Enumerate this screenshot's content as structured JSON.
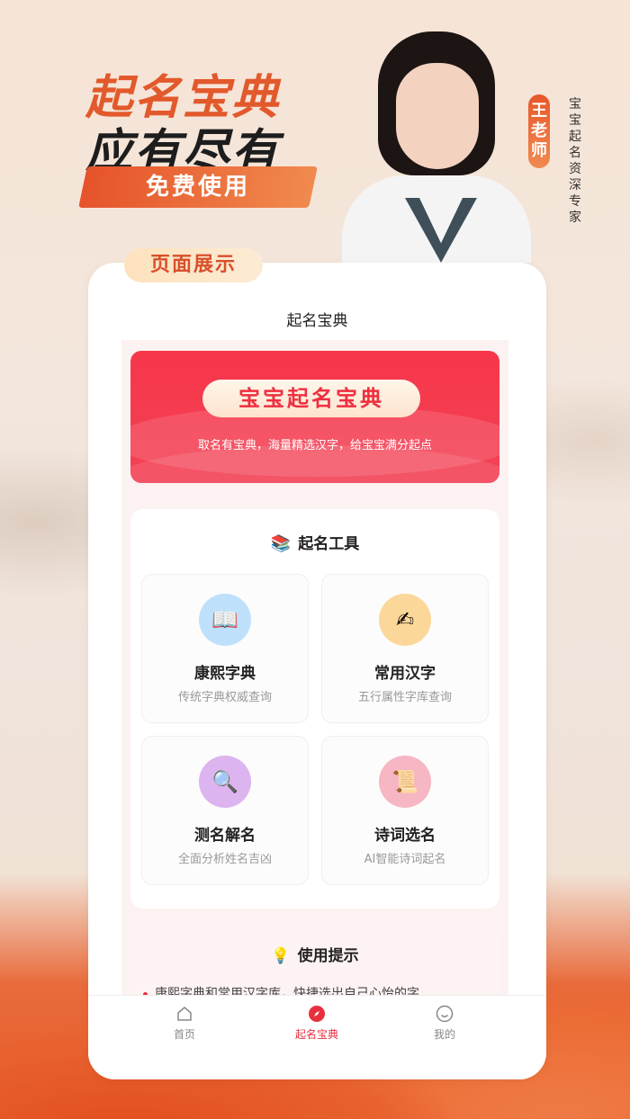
{
  "hero": {
    "line1": "起名宝典",
    "line2": "应有尽有",
    "free": "免费使用"
  },
  "teacher": {
    "name": "王老师",
    "title": "宝宝起名资深专家"
  },
  "page_tag": "页面展示",
  "app": {
    "nav_title": "起名宝典",
    "banner": {
      "pill": "宝宝起名宝典",
      "subtitle": "取名有宝典，海量精选汉字，给宝宝满分起点"
    },
    "tools": {
      "title": "起名工具",
      "icon": "books-icon",
      "items": [
        {
          "name": "康熙字典",
          "desc": "传统字典权威查询",
          "icon": "book-icon",
          "color": "#bfe0fb"
        },
        {
          "name": "常用汉字",
          "desc": "五行属性字库查询",
          "icon": "writing-icon",
          "color": "#fcd79a"
        },
        {
          "name": "测名解名",
          "desc": "全面分析姓名吉凶",
          "icon": "magnifier-icon",
          "color": "#dcb4ef"
        },
        {
          "name": "诗词选名",
          "desc": "AI智能诗词起名",
          "icon": "scroll-icon",
          "color": "#f7b6c3"
        }
      ]
    },
    "tips": {
      "title": "使用提示",
      "icon": "lightbulb-icon",
      "line": "康熙字典和常用汉字库，快捷选出自己心怡的字"
    },
    "tabbar": [
      {
        "label": "首页",
        "icon": "home-icon",
        "active": false
      },
      {
        "label": "起名宝典",
        "icon": "compass-icon",
        "active": true
      },
      {
        "label": "我的",
        "icon": "smile-icon",
        "active": false
      }
    ]
  },
  "colors": {
    "accent": "#e8303f",
    "orange": "#e2592b"
  }
}
